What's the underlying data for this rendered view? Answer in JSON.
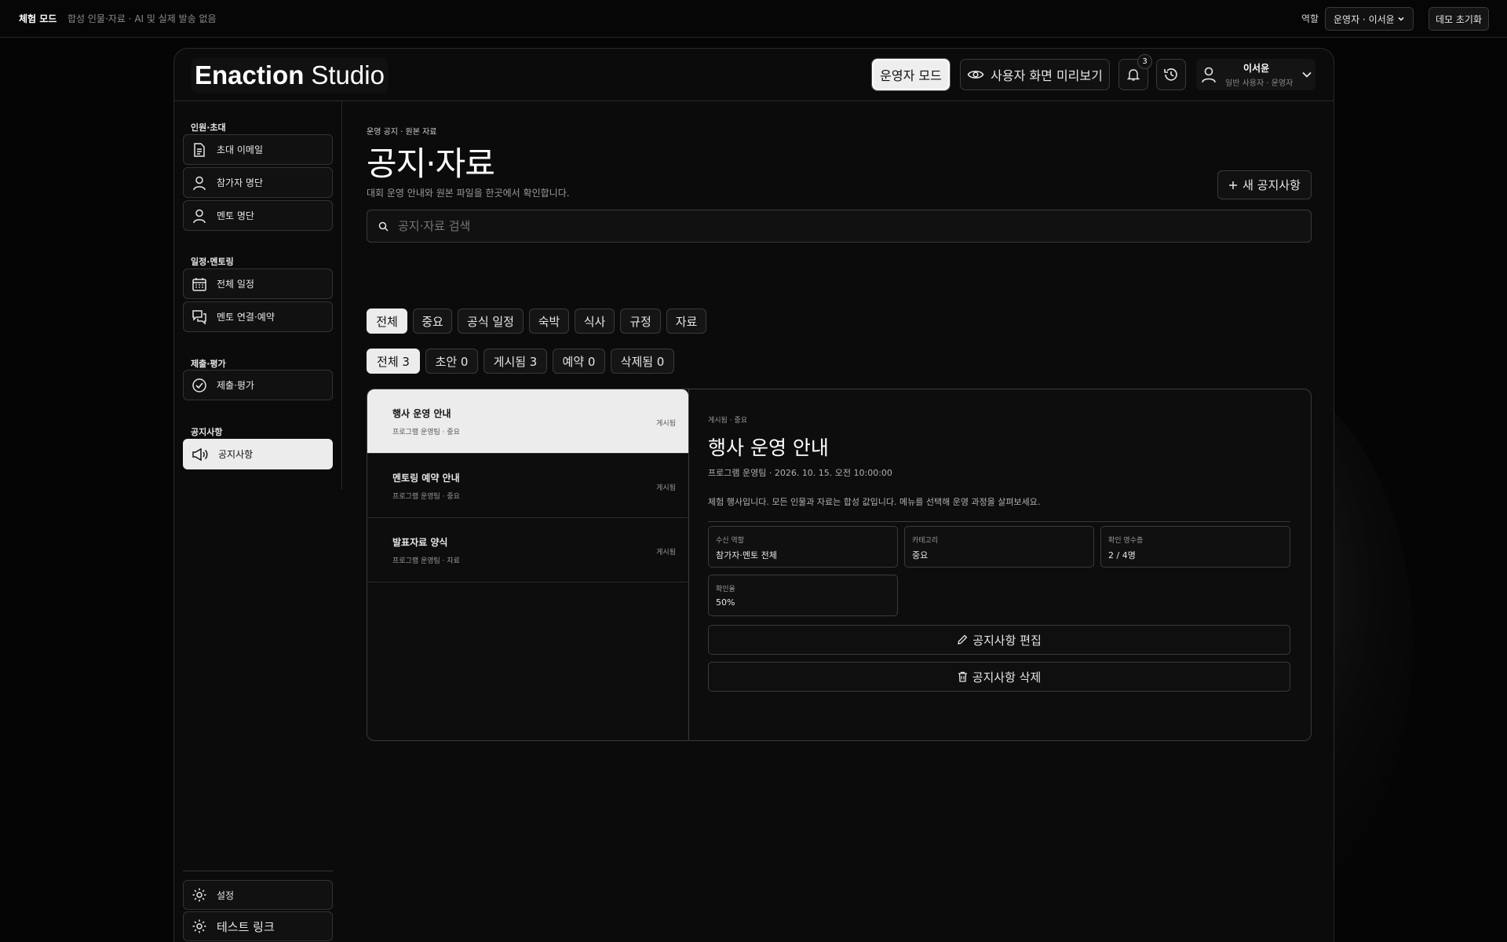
{
  "topbar": {
    "mode_label": "체험 모드",
    "mode_desc": "합성 인물·자료 · AI 및 실제 발송 없음",
    "role_label": "역할",
    "role_value": "운영자 · 이서윤",
    "reset_label": "데모 초기화"
  },
  "header": {
    "brand_bold": "Enaction",
    "brand_light": "Studio",
    "operator_mode": "운영자 모드",
    "preview_label": "사용자 화면 미리보기",
    "notification_count": "3",
    "user_name": "이서윤",
    "user_sub": "일반 사용자 · 운영자"
  },
  "sidebar": {
    "sections": [
      {
        "title": "인원·초대",
        "items": [
          {
            "label": "초대 이메일",
            "icon": "document-icon"
          },
          {
            "label": "참가자 명단",
            "icon": "user-icon"
          },
          {
            "label": "멘토 명단",
            "icon": "user-icon"
          }
        ]
      },
      {
        "title": "일정·멘토링",
        "items": [
          {
            "label": "전체 일정",
            "icon": "calendar-icon"
          },
          {
            "label": "멘토 연결·예약",
            "icon": "chat-icon"
          }
        ]
      },
      {
        "title": "제출·평가",
        "items": [
          {
            "label": "제출·평가",
            "icon": "check-circle-icon"
          }
        ]
      },
      {
        "title": "공지사항",
        "items": [
          {
            "label": "공지사항",
            "icon": "megaphone-icon"
          }
        ]
      }
    ],
    "settings_label": "설정",
    "test_link_label": "테스트 링크"
  },
  "main": {
    "breadcrumb": "운영 공지 · 원본 자료",
    "title": "공지·자료",
    "description": "대회 운영 안내와 원본 파일을 한곳에서 확인합니다.",
    "new_button": "새 공지사항",
    "search_placeholder": "공지·자료 검색",
    "category_filters": [
      "전체",
      "중요",
      "공식 일정",
      "숙박",
      "식사",
      "규정",
      "자료"
    ],
    "status_filters": [
      "전체 3",
      "초안 0",
      "게시됨 3",
      "예약 0",
      "삭제됨 0"
    ]
  },
  "notices": [
    {
      "title": "행사 운영 안내",
      "sub": "프로그램 운영팀 · 중요",
      "status": "게시됨"
    },
    {
      "title": "멘토링 예약 안내",
      "sub": "프로그램 운영팀 · 중요",
      "status": "게시됨"
    },
    {
      "title": "발표자료 양식",
      "sub": "프로그램 운영팀 · 자료",
      "status": "게시됨"
    }
  ],
  "detail": {
    "meta": "게시됨 · 중요",
    "title": "행사 운영 안내",
    "sub": "프로그램 운영팀 · 2026. 10. 15. 오전 10:00:00",
    "body": "체험 행사입니다. 모든 인물과 자료는 합성 값입니다. 메뉴를 선택해 운영 과정을 살펴보세요.",
    "stats": [
      {
        "label": "수신 역할",
        "value": "참가자·멘토 전체"
      },
      {
        "label": "카테고리",
        "value": "중요"
      },
      {
        "label": "확인 영수증",
        "value": "2 / 4명"
      },
      {
        "label": "확인율",
        "value": "50%"
      }
    ],
    "edit_label": "공지사항 편집",
    "delete_label": "공지사항 삭제"
  }
}
